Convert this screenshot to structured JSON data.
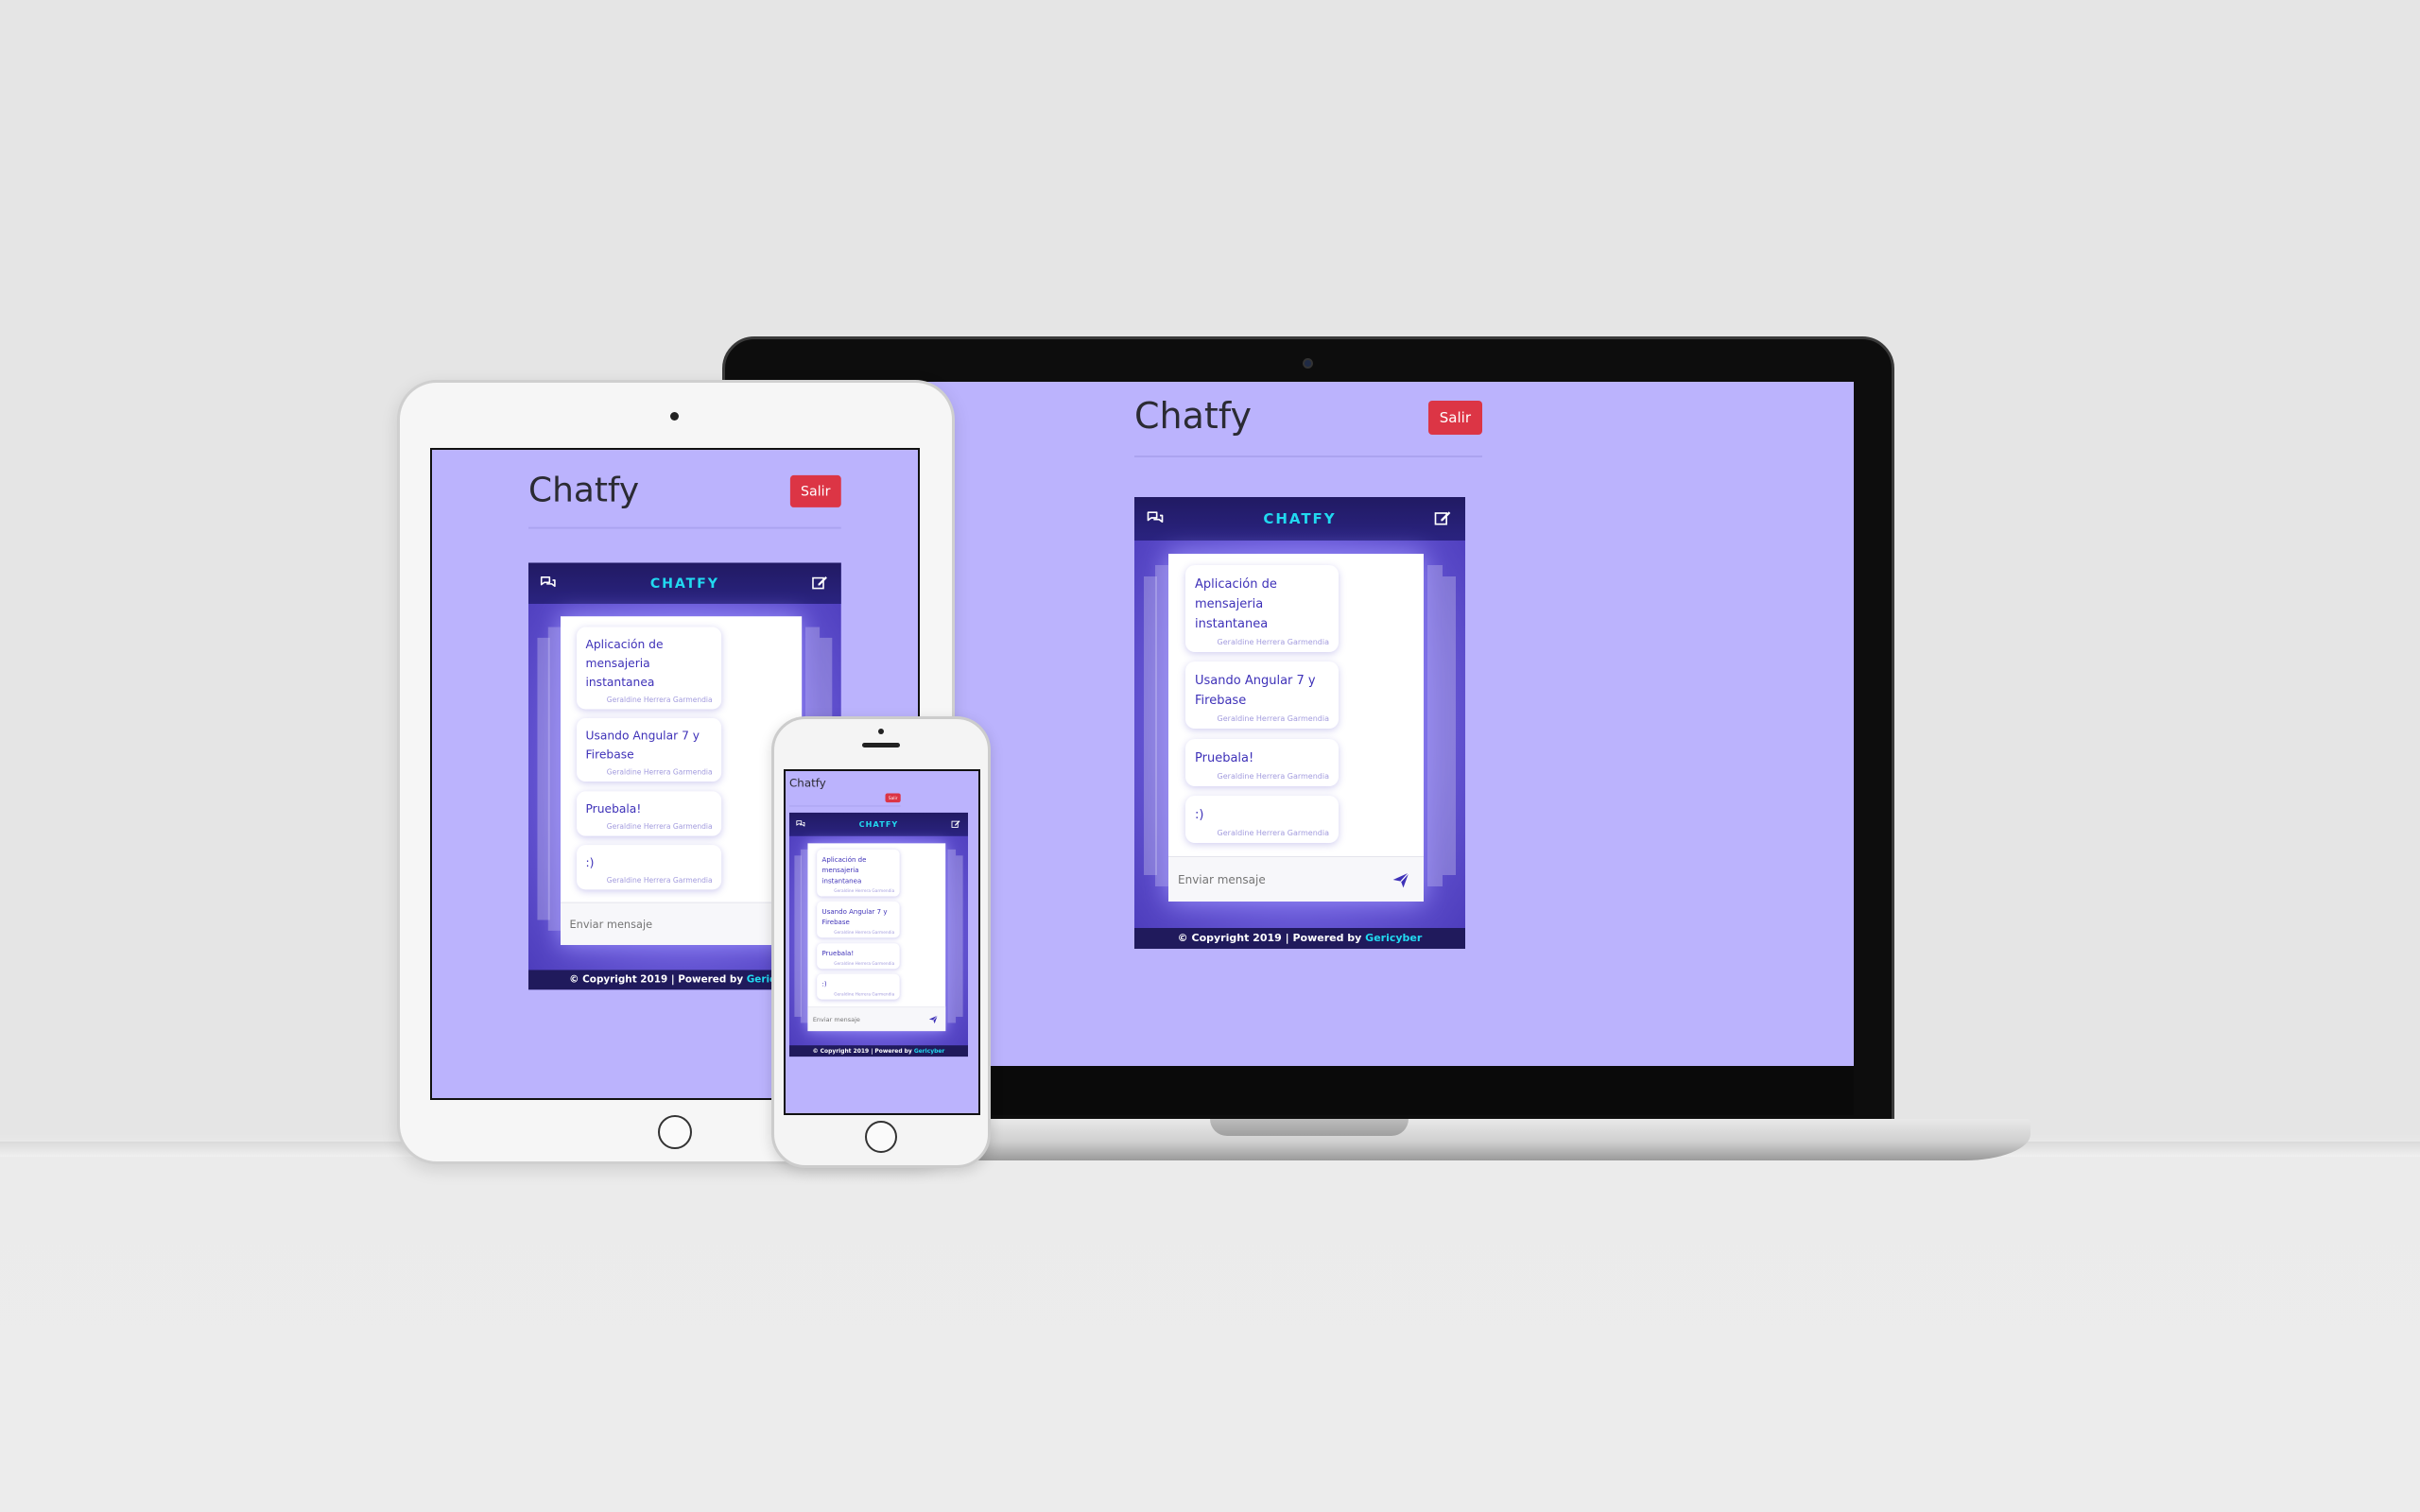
{
  "app": {
    "title": "Chatfy",
    "logout_label": "Salir",
    "chat_title": "CHATFY",
    "messages": [
      {
        "text": "Aplicación de mensajeria instantanea",
        "author": "Geraldine Herrera Garmendia"
      },
      {
        "text": "Usando Angular 7 y Firebase",
        "author": "Geraldine Herrera Garmendia"
      },
      {
        "text": "Pruebala!",
        "author": "Geraldine Herrera Garmendia"
      },
      {
        "text": ":)",
        "author": "Geraldine Herrera Garmendia"
      }
    ],
    "send_placeholder": "Enviar mensaje",
    "footer_text": "© Copyright 2019 | Powered by ",
    "footer_link": "Gericyber"
  },
  "devices": [
    "laptop",
    "tablet",
    "phone"
  ],
  "icons": {
    "chat": "chat-bubbles-icon",
    "compose": "edit-icon",
    "send": "paper-plane-icon"
  },
  "colors": {
    "background": "#bbb3fd",
    "chat_bar": "#211a63",
    "chat_title": "#21d9f0",
    "logout_button": "#dc3545",
    "message_text": "#3e31b8"
  }
}
